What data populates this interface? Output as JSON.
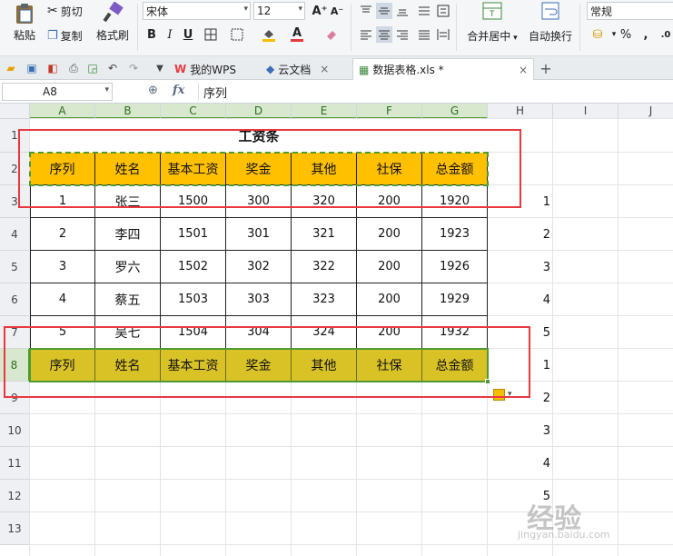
{
  "ribbon": {
    "paste": "粘贴",
    "cut": "剪切",
    "copy": "复制",
    "format_painter": "格式刷",
    "font_name": "宋体",
    "font_size": "12",
    "bold": "B",
    "italic": "I",
    "underline": "U",
    "merge_center": "合并居中",
    "auto_wrap": "自动换行",
    "number_format": "常规",
    "percent": "%",
    "increase_font": "A⁺",
    "decrease_font": "A⁻",
    "font_color_letter": "A",
    "accent_colors": {
      "fill": "#f2c000",
      "font": "#e8393f"
    }
  },
  "tabs": [
    {
      "label": "我的WPS",
      "icon": "wps-logo-icon"
    },
    {
      "label": "云文档",
      "icon": "cloud-cube-icon"
    },
    {
      "label": "数据表格.xls *",
      "icon": "spreadsheet-icon",
      "active": true
    }
  ],
  "formula_bar": {
    "cell_ref": "A8",
    "fx": "fx",
    "content": "序列"
  },
  "sheet": {
    "columns": [
      "A",
      "B",
      "C",
      "D",
      "E",
      "F",
      "G",
      "H",
      "I",
      "J"
    ],
    "rows": [
      "1",
      "2",
      "3",
      "4",
      "5",
      "6",
      "7",
      "8",
      "9",
      "10",
      "11",
      "12",
      "13"
    ],
    "title": "工资条",
    "header": [
      "序列",
      "姓名",
      "基本工资",
      "奖金",
      "其他",
      "社保",
      "总金额"
    ],
    "data": [
      [
        "1",
        "张三",
        "1500",
        "300",
        "320",
        "200",
        "1920"
      ],
      [
        "2",
        "李四",
        "1501",
        "301",
        "321",
        "200",
        "1923"
      ],
      [
        "3",
        "罗六",
        "1502",
        "302",
        "322",
        "200",
        "1926"
      ],
      [
        "4",
        "蔡五",
        "1503",
        "303",
        "323",
        "200",
        "1929"
      ],
      [
        "5",
        "吴七",
        "1504",
        "304",
        "324",
        "200",
        "1932"
      ]
    ],
    "pasted_header": [
      "序列",
      "姓名",
      "基本工资",
      "奖金",
      "其他",
      "社保",
      "总金额"
    ],
    "helper_column": [
      "1",
      "2",
      "3",
      "4",
      "5",
      "1",
      "2",
      "3",
      "4",
      "5"
    ],
    "colors": {
      "header_fill": "#ffc000",
      "selected_fill": "#d9c226",
      "selection": "#4e9a33",
      "annotation": "#e8393f"
    }
  },
  "watermark": {
    "text": "经验",
    "subtext": "jingyan.baidu.com"
  }
}
